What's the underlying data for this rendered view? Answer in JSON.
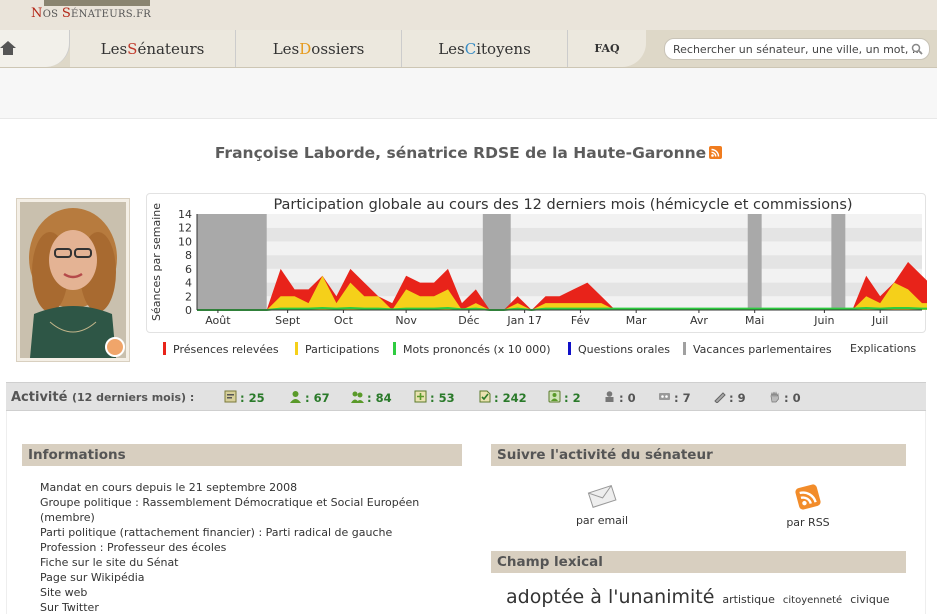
{
  "header": {
    "logo_prefix": "N",
    "logo_os": "OS ",
    "logo_s": "S",
    "logo_rest": "ÉNATEURS.FR",
    "nav": [
      {
        "initial": "S",
        "before": "Les ",
        "rest": "énateurs",
        "initial_color": "#c0392b"
      },
      {
        "initial": "D",
        "before": "Les ",
        "rest": "ossiers",
        "initial_color": "#e69a1c"
      },
      {
        "initial": "C",
        "before": "Les ",
        "rest": "itoyens",
        "initial_color": "#3a8dc5"
      }
    ],
    "faq": "FAQ",
    "search_placeholder": "Rechercher un sénateur, une ville, un mot, ..."
  },
  "title": "Françoise Laborde, sénatrice RDSE de la Haute-Garonne",
  "chart_data": {
    "type": "area",
    "title": "Participation globale au cours des 12 derniers mois (hémicycle et commissions)",
    "ylabel": "Séances par semaine",
    "ylim": [
      0,
      14
    ],
    "yticks": [
      "0",
      "2",
      "4",
      "6",
      "8",
      "10",
      "12",
      "14"
    ],
    "xticks": [
      {
        "label": "Août",
        "week": 1.5
      },
      {
        "label": "Sept",
        "week": 6.5
      },
      {
        "label": "Oct",
        "week": 10.5
      },
      {
        "label": "Nov",
        "week": 15
      },
      {
        "label": "Déc",
        "week": 19.5
      },
      {
        "label": "Jan 17",
        "week": 23.5
      },
      {
        "label": "Fév",
        "week": 27.5
      },
      {
        "label": "Mar",
        "week": 31.5
      },
      {
        "label": "Avr",
        "week": 36
      },
      {
        "label": "Mai",
        "week": 40
      },
      {
        "label": "Juin",
        "week": 45
      },
      {
        "label": "Juil",
        "week": 49
      }
    ],
    "weeks": 52,
    "vacations": [
      [
        0,
        5
      ],
      [
        20.5,
        22.5
      ],
      [
        39.5,
        40.5
      ],
      [
        45.5,
        46.5
      ]
    ],
    "series": [
      {
        "name": "Présences relevées",
        "color": "#e8231a",
        "values": [
          0,
          0,
          0,
          0,
          0,
          0,
          6,
          3,
          3,
          5,
          2,
          6,
          4,
          2,
          1,
          5,
          4,
          4,
          6,
          1,
          3,
          0,
          0,
          2,
          0,
          2,
          2,
          3,
          4,
          2,
          0,
          0,
          0,
          0,
          0,
          0,
          0,
          0,
          0,
          0,
          0,
          0,
          0,
          0,
          0,
          0,
          0,
          0,
          5,
          2,
          4,
          7,
          5,
          3
        ]
      },
      {
        "name": "Participations",
        "color": "#f5d01a",
        "values": [
          0,
          0,
          0,
          0,
          0,
          0,
          2,
          2,
          1,
          5,
          1,
          4,
          2,
          2,
          0,
          3,
          2,
          2,
          3,
          0,
          1,
          0,
          0,
          1,
          0,
          1,
          1,
          1,
          1,
          1,
          0,
          0,
          0,
          0,
          0,
          0,
          0,
          0,
          0,
          0,
          0,
          0,
          0,
          0,
          0,
          0,
          0,
          0,
          2,
          1,
          4,
          3,
          1,
          1
        ]
      },
      {
        "name": "Mots prononcés (x 10 000)",
        "color": "#2ecc40",
        "values": [
          0,
          0,
          0,
          0,
          0,
          0,
          0.2,
          0.2,
          0.2,
          0.3,
          0.2,
          0.3,
          0.2,
          0.2,
          0.1,
          0.2,
          0.2,
          0.2,
          0.3,
          0.1,
          0.2,
          0,
          0,
          0.2,
          0,
          0.2,
          0.2,
          0.2,
          0.2,
          0.2,
          0.2,
          0.2,
          0.2,
          0.2,
          0.2,
          0.2,
          0.2,
          0.2,
          0.2,
          0.2,
          0.2,
          0.2,
          0.2,
          0.2,
          0.2,
          0.2,
          0.2,
          0.2,
          0.3,
          0.2,
          0.3,
          0.3,
          0.2,
          0.2
        ]
      }
    ],
    "legend": [
      {
        "label": "Présences relevées",
        "color": "#e8231a"
      },
      {
        "label": "Participations",
        "color": "#f5d01a"
      },
      {
        "label": "Mots prononcés (x 10 000)",
        "color": "#2ecc40"
      },
      {
        "label": "Questions orales",
        "color": "#1010c8"
      },
      {
        "label": "Vacances parlementaires",
        "color": "#a0a0a0"
      },
      {
        "label": "Explications",
        "color": ""
      }
    ]
  },
  "activity": {
    "title": "Activité",
    "subtitle": "(12 derniers mois) :",
    "stats": [
      {
        "icon": "semaines-icon",
        "value": ": 25"
      },
      {
        "icon": "commission-icon",
        "value": ": 67"
      },
      {
        "icon": "interventions-icon",
        "value": ": 84"
      },
      {
        "icon": "amendements-icon",
        "value": ": 53"
      },
      {
        "icon": "amendements-adoptes-icon",
        "value": ": 242"
      },
      {
        "icon": "rapports-icon",
        "value": ": 2"
      },
      {
        "icon": "propositions-icon",
        "value": ": 0"
      },
      {
        "icon": "questions-ecrites-icon",
        "value": ": 7"
      },
      {
        "icon": "pencil-icon",
        "value": ": 9"
      },
      {
        "icon": "hand-icon",
        "value": ": 0"
      }
    ]
  },
  "informations": {
    "title": "Informations",
    "rows": [
      "Mandat en cours depuis le 21 septembre 2008",
      "Groupe politique : Rassemblement Démocratique et Social Européen (membre)",
      "Parti politique (rattachement financier) : Parti radical de gauche",
      "Profession : Professeur des écoles",
      "Fiche sur le site du Sénat",
      "Page sur Wikipédia",
      "Site web",
      "Sur Twitter"
    ]
  },
  "follow": {
    "title": "Suivre l'activité du sénateur",
    "email": "par email",
    "rss": "par RSS"
  },
  "lexical": {
    "title": "Champ lexical",
    "words": [
      {
        "text": "adoptée à l'unanimité",
        "size": 19
      },
      {
        "text": "artistique",
        "size": 11
      },
      {
        "text": "citoyenneté",
        "size": 10
      },
      {
        "text": "civique",
        "size": 11
      }
    ]
  }
}
